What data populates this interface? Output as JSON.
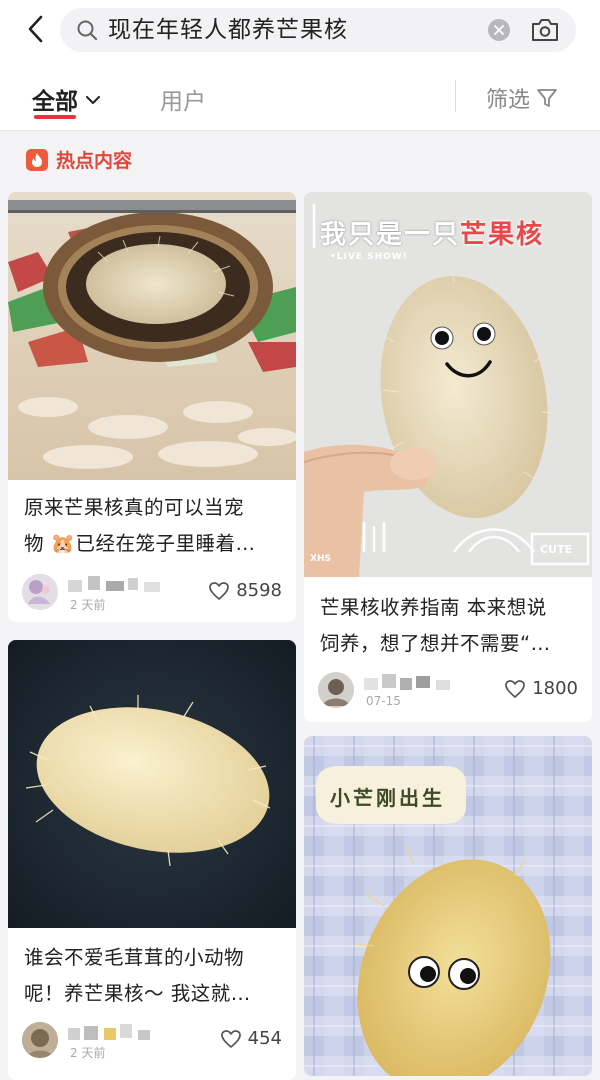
{
  "search": {
    "query": "现在年轻人都养芒果核"
  },
  "tabs": {
    "all_label": "全部",
    "users_label": "用户",
    "filter_label": "筛选"
  },
  "section": {
    "hot_label": "热点内容"
  },
  "cards": [
    {
      "title_line1": "原来芒果核真的可以当宠",
      "title_line2": "物 🐹已经在笼子里睡着…",
      "timestamp": "2 天前",
      "likes": "8598"
    },
    {
      "overlay_title_a": "我只是一只",
      "overlay_title_b": "芒果核",
      "overlay_sub": "•LIVE SHOW!",
      "overlay_badge_a": "XHS",
      "overlay_badge_b": "CUTE",
      "title_line1": "芒果核收养指南 本来想说",
      "title_line2": "饲养，想了想并不需要“…",
      "timestamp": "07-15",
      "likes": "1800"
    },
    {
      "title_line1": "谁会不爱毛茸茸的小动物",
      "title_line2": "呢！养芒果核～ 我这就…",
      "timestamp": "2 天前",
      "likes": "454"
    },
    {
      "overlay_title": "小芒刚出生"
    }
  ],
  "colors": {
    "accent": "#e6343f",
    "hot": "#e0493a"
  }
}
